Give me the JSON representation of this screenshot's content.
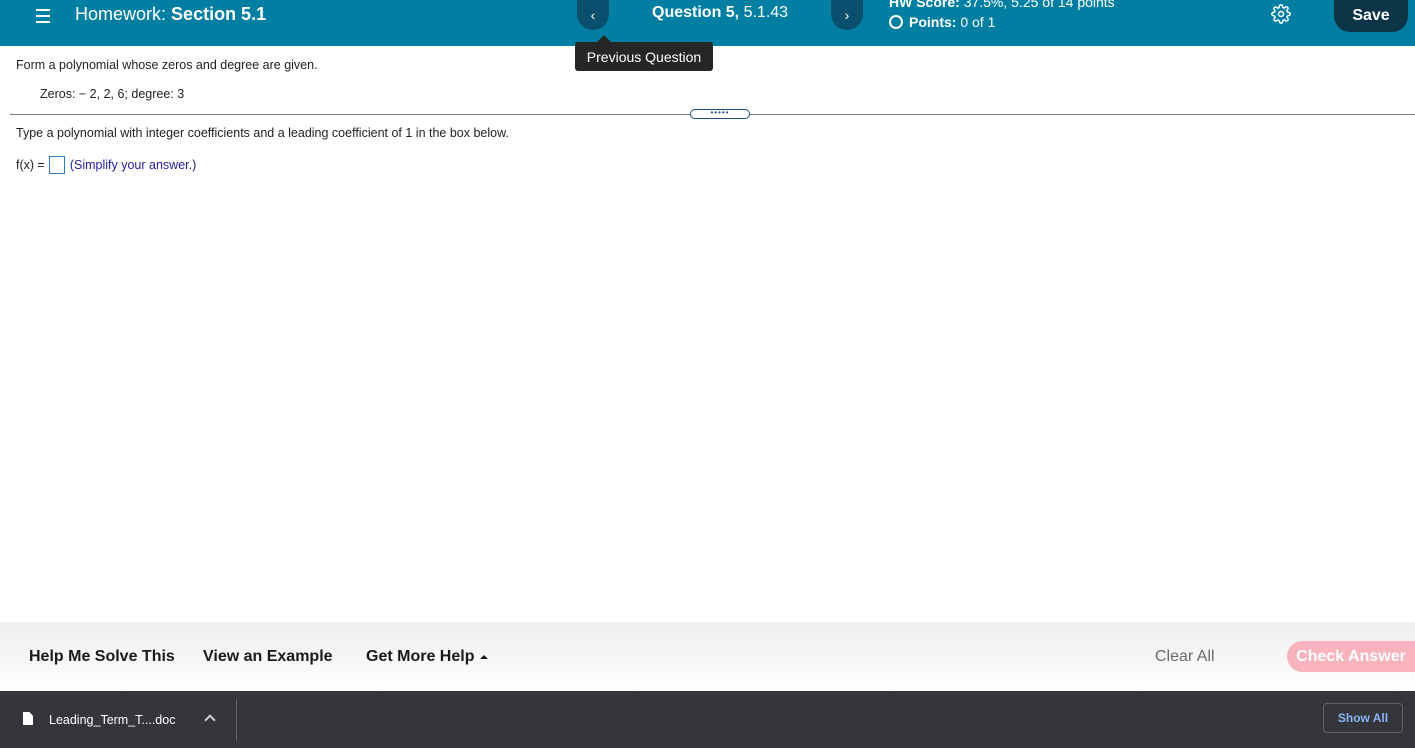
{
  "header": {
    "hw_prefix": "Homework:",
    "hw_section": "Section 5.1",
    "question_bold": "Question 5,",
    "question_id": "5.1.43",
    "prev_symbol": "‹",
    "next_symbol": "›",
    "hw_score_label": "HW Score:",
    "hw_score_value": "37.5%, 5.25 of 14 points",
    "points_label": "Points:",
    "points_value": "0 of 1",
    "save_label": "Save",
    "tooltip": "Previous Question"
  },
  "question": {
    "prompt": "Form a polynomial whose zeros and degree are given.",
    "zeros_line": "Zeros:  − 2, 2, 6;   degree: 3",
    "divider_dots": "•••••",
    "instructions": "Type a polynomial with integer coefficients and a leading coefficient of 1 in the box below.",
    "answer_prefix": "f(x) =",
    "answer_value": "",
    "simplify_hint": "(Simplify your answer.)"
  },
  "help_bar": {
    "help_me_solve": "Help Me Solve This",
    "view_example": "View an Example",
    "get_more_help": "Get More Help",
    "clear_all": "Clear All",
    "check_answer": "Check Answer"
  },
  "download_bar": {
    "file_name": "Leading_Term_T....doc",
    "show_all": "Show All"
  },
  "colors": {
    "header_bg": "#007fa3",
    "nav_button_bg": "#0a4f6e",
    "save_bg": "#0c3447",
    "check_answer_bg": "#f8b3bd",
    "hint_text": "#1d1f9a",
    "download_bar_bg": "#35363a"
  }
}
